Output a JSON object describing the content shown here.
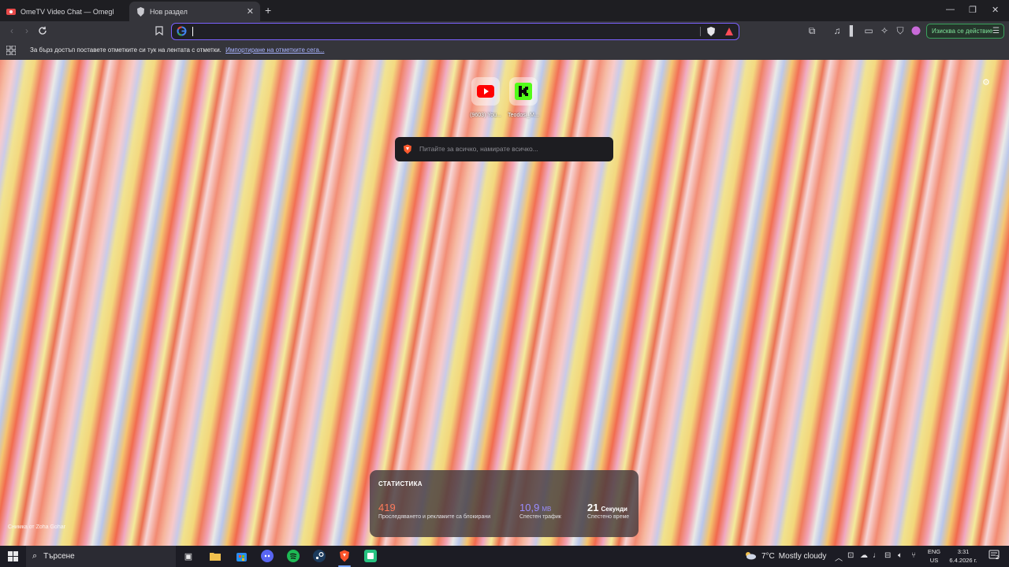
{
  "tabs": [
    {
      "title": "OmeTV Video Chat — Omegle R",
      "active": false,
      "icon": "ometv-icon"
    },
    {
      "title": "Нов раздел",
      "active": true,
      "icon": "brave-icon"
    }
  ],
  "toolbar": {
    "address_value": "",
    "action_button": "Изисква се действие"
  },
  "bookmarks_bar": {
    "text": "За бърз достъп поставете отметките си тук на лентата с отметки.",
    "link": "Импортиране на отметките сега..."
  },
  "newtab": {
    "top_sites": [
      {
        "label": "(9603) You...",
        "icon": "youtube-icon"
      },
      {
        "label": "Teodosi_M...",
        "icon": "kick-icon"
      }
    ],
    "search_placeholder": "Питайте за всичко, намирате всичко...",
    "photo_credit": "Снимка от Zoha Gohar",
    "stats": {
      "heading": "СТАТИСТИКА",
      "blocked_count": "419",
      "blocked_label": "Проследяването и рекламите са блокирани",
      "bandwidth_value": "10,9",
      "bandwidth_unit": "MB",
      "bandwidth_label": "Спестен трафик",
      "time_value": "21",
      "time_unit": "Секунди",
      "time_label": "Спестено време"
    }
  },
  "taskbar": {
    "search_label": "Търсене",
    "weather_temp": "7°C",
    "weather_desc": "Mostly cloudy",
    "lang_top": "ENG",
    "lang_bottom": "US",
    "time": "3:31",
    "date": "6.4.2026 г.",
    "notifications": "2"
  },
  "colors": {
    "accent": "#7b61ff",
    "action_green": "#3aa35c",
    "stat_orange": "#ff7a5a",
    "stat_purple": "#9a8dff"
  }
}
